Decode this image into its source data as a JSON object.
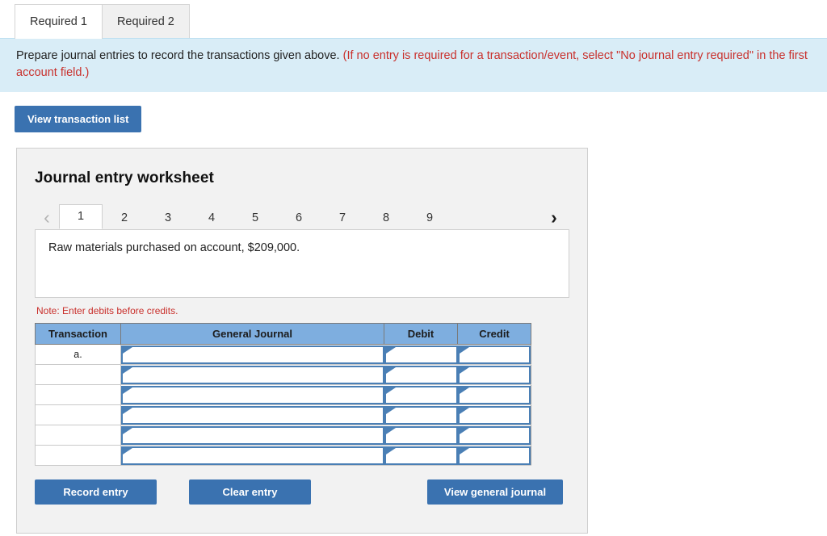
{
  "tabs": [
    {
      "label": "Required 1",
      "active": true
    },
    {
      "label": "Required 2",
      "active": false
    }
  ],
  "banner": {
    "text": "Prepare journal entries to record the transactions given above.",
    "hint": "(If no entry is required for a transaction/event, select \"No journal entry required\" in the first account field.)",
    "background_color": "#d9edf7",
    "hint_color": "#c9302c"
  },
  "toolbar": {
    "view_transaction_list_label": "View transaction list"
  },
  "worksheet": {
    "title": "Journal entry worksheet",
    "pager": {
      "prev_icon": "chevron-left-icon",
      "next_icon": "chevron-right-icon",
      "prev_glyph": "‹",
      "next_glyph": "›",
      "pages": [
        "1",
        "2",
        "3",
        "4",
        "5",
        "6",
        "7",
        "8",
        "9"
      ],
      "active_page": "1"
    },
    "description": "Raw materials purchased on account, $209,000.",
    "note": "Note: Enter debits before credits.",
    "table": {
      "headers": [
        "Transaction",
        "General Journal",
        "Debit",
        "Credit"
      ],
      "header_color": "#7eaedf",
      "rows": [
        {
          "transaction": "a.",
          "general_journal": "",
          "debit": "",
          "credit": ""
        },
        {
          "transaction": "",
          "general_journal": "",
          "debit": "",
          "credit": ""
        },
        {
          "transaction": "",
          "general_journal": "",
          "debit": "",
          "credit": ""
        },
        {
          "transaction": "",
          "general_journal": "",
          "debit": "",
          "credit": ""
        },
        {
          "transaction": "",
          "general_journal": "",
          "debit": "",
          "credit": ""
        },
        {
          "transaction": "",
          "general_journal": "",
          "debit": "",
          "credit": ""
        }
      ]
    },
    "actions": {
      "record_entry_label": "Record entry",
      "clear_entry_label": "Clear entry",
      "view_general_journal_label": "View general journal",
      "button_color": "#3a72b0"
    }
  }
}
